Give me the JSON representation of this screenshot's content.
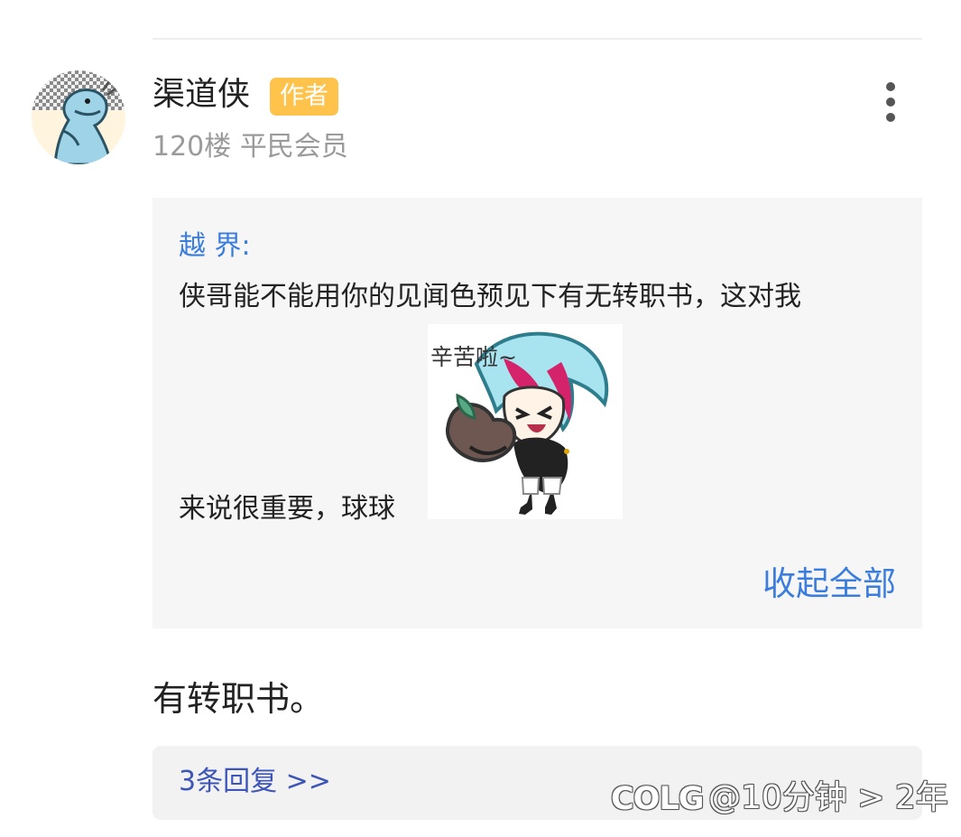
{
  "post": {
    "username": "渠道侠",
    "badge": "作者",
    "floor": "120楼",
    "rank": "平民会员",
    "more_icon": "more-vertical-icon"
  },
  "quote": {
    "author": "越 界:",
    "line1": "侠哥能不能用你的见闻色预见下有无转职书，这对我",
    "line2": "来说很重要，球球",
    "sticker_text": "辛苦啦~",
    "collapse_label": "收起全部"
  },
  "reply": {
    "text": "有转职书。",
    "replies_label": "3条回复 >>"
  },
  "watermark": {
    "logo": "COLG",
    "text": "@10分钟 > 2年"
  },
  "colors": {
    "accent": "#3b7ddd",
    "badge": "#ffc24a",
    "quote_bg": "#f6f6f6",
    "replies_bg": "#f2f2f2"
  }
}
